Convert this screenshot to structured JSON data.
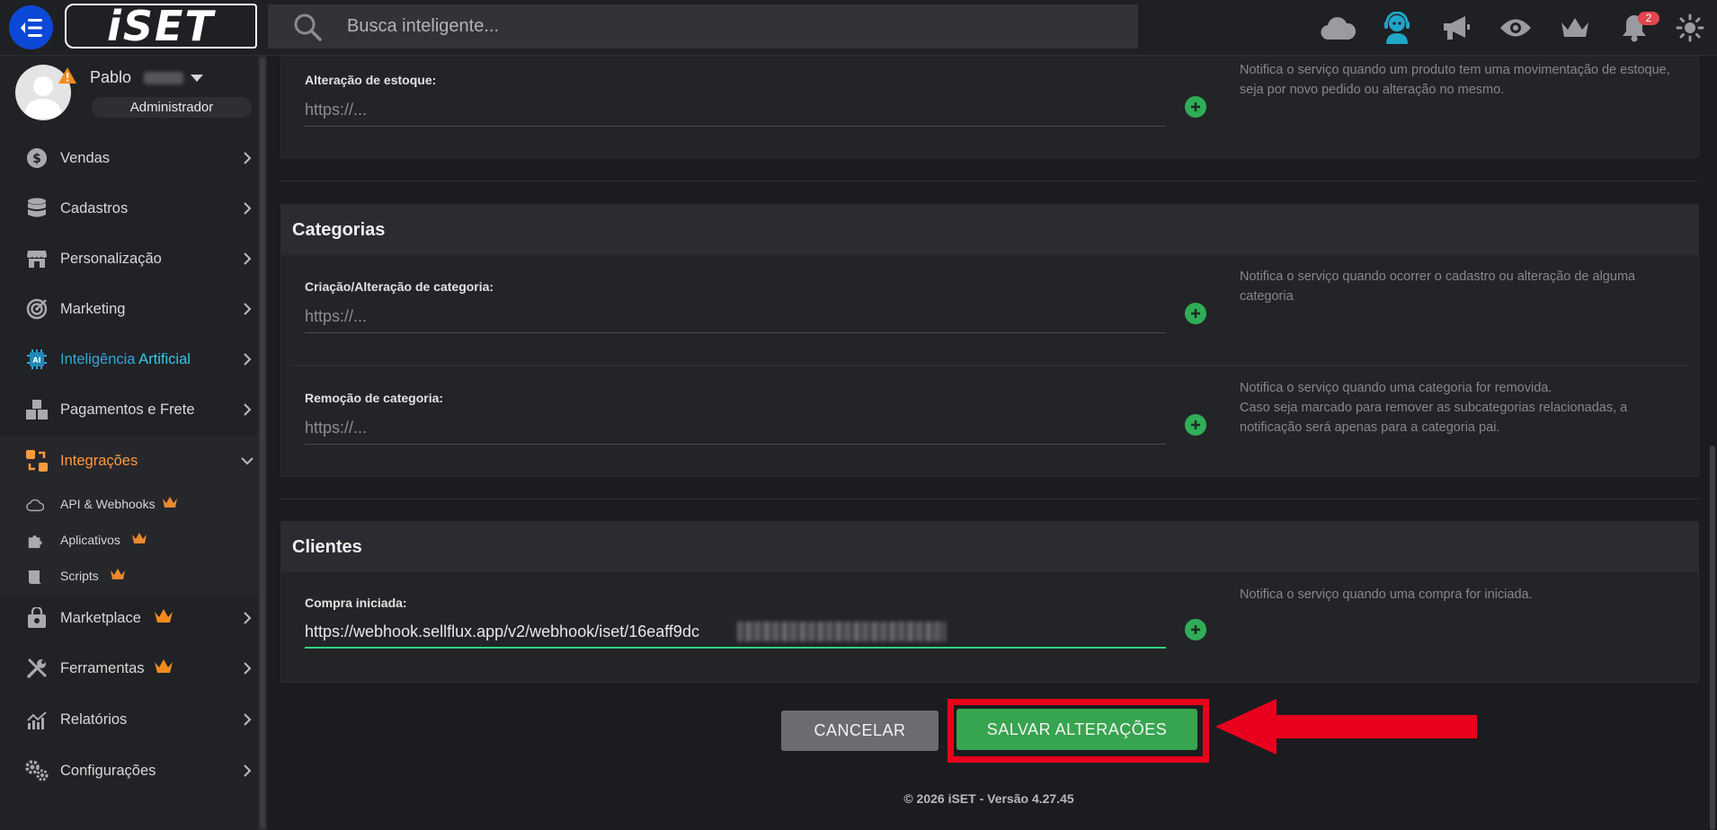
{
  "search": {
    "placeholder": "Busca inteligente..."
  },
  "top_icons": [
    "cloud-icon",
    "support-agent-icon",
    "megaphone-icon",
    "eye-icon",
    "crown-icon",
    "bell-icon",
    "sun-icon"
  ],
  "notifications": {
    "count": "2"
  },
  "user": {
    "name": "Pablo",
    "role": "Administrador"
  },
  "sidebar": {
    "items": [
      {
        "label": "Vendas",
        "icon": "dollar-icon"
      },
      {
        "label": "Cadastros",
        "icon": "database-icon"
      },
      {
        "label": "Personalização",
        "icon": "store-icon"
      },
      {
        "label": "Marketing",
        "icon": "target-icon"
      },
      {
        "label": "Inteligência Artificial",
        "label_a": "Inteligência ",
        "label_b": "Artificial",
        "icon": "ai-chip-icon"
      },
      {
        "label": "Pagamentos e Frete",
        "icon": "boxes-icon"
      },
      {
        "label": "Integrações",
        "icon": "integrations-icon"
      },
      {
        "label": "Marketplace",
        "icon": "bag-icon"
      },
      {
        "label": "Ferramentas",
        "icon": "tools-icon"
      },
      {
        "label": "Relatórios",
        "icon": "chart-icon"
      },
      {
        "label": "Configurações",
        "icon": "gears-icon"
      }
    ],
    "submenu": [
      {
        "label": "API & Webhooks",
        "icon": "cloud-outline-icon"
      },
      {
        "label": "Aplicativos",
        "icon": "puzzle-icon"
      },
      {
        "label": "Scripts",
        "icon": "scroll-icon"
      }
    ]
  },
  "sections": {
    "produtos": {
      "fields": [
        {
          "label": "Alteração de estoque:",
          "placeholder": "https://...",
          "help": "Notifica o serviço quando um produto tem uma movimentação de estoque, seja por novo pedido ou alteração no mesmo."
        }
      ]
    },
    "categorias": {
      "title": "Categorias",
      "fields": [
        {
          "label": "Criação/Alteração de categoria:",
          "placeholder": "https://...",
          "help": "Notifica o serviço quando ocorrer o cadastro ou alteração de alguma categoria"
        },
        {
          "label": "Remoção de categoria:",
          "placeholder": "https://...",
          "help_1": "Notifica o serviço quando uma categoria for removida.",
          "help_2": "Caso seja marcado para remover as subcategorias relacionadas, a notificação será apenas para a categoria pai."
        }
      ]
    },
    "clientes": {
      "title": "Clientes",
      "fields": [
        {
          "label": "Compra iniciada:",
          "value": "https://webhook.sellflux.app/v2/webhook/iset/16eaff9dc",
          "help": "Notifica o serviço quando uma compra for iniciada."
        }
      ]
    }
  },
  "actions": {
    "cancel": "CANCELAR",
    "save": "SALVAR ALTERAÇÕES"
  },
  "footer": "© 2026 iSET - Versão 4.27.45",
  "colors": {
    "accent_orange": "#ff9a3c",
    "ai_blue": "#31a7d6",
    "save_green": "#37a44f",
    "highlight_red": "#e8001c"
  }
}
